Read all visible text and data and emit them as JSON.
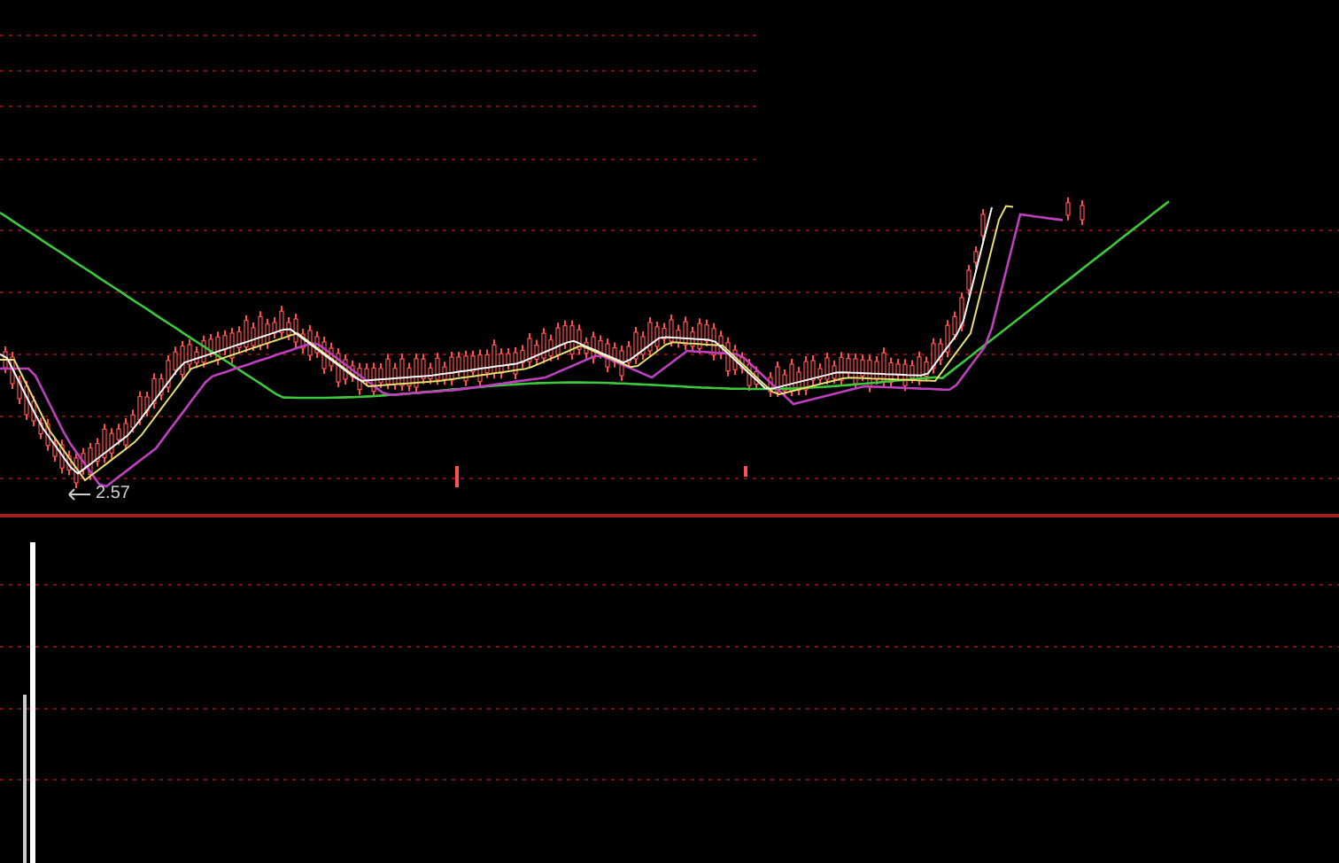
{
  "price_panel": {
    "low_label": "2.57"
  }
}
